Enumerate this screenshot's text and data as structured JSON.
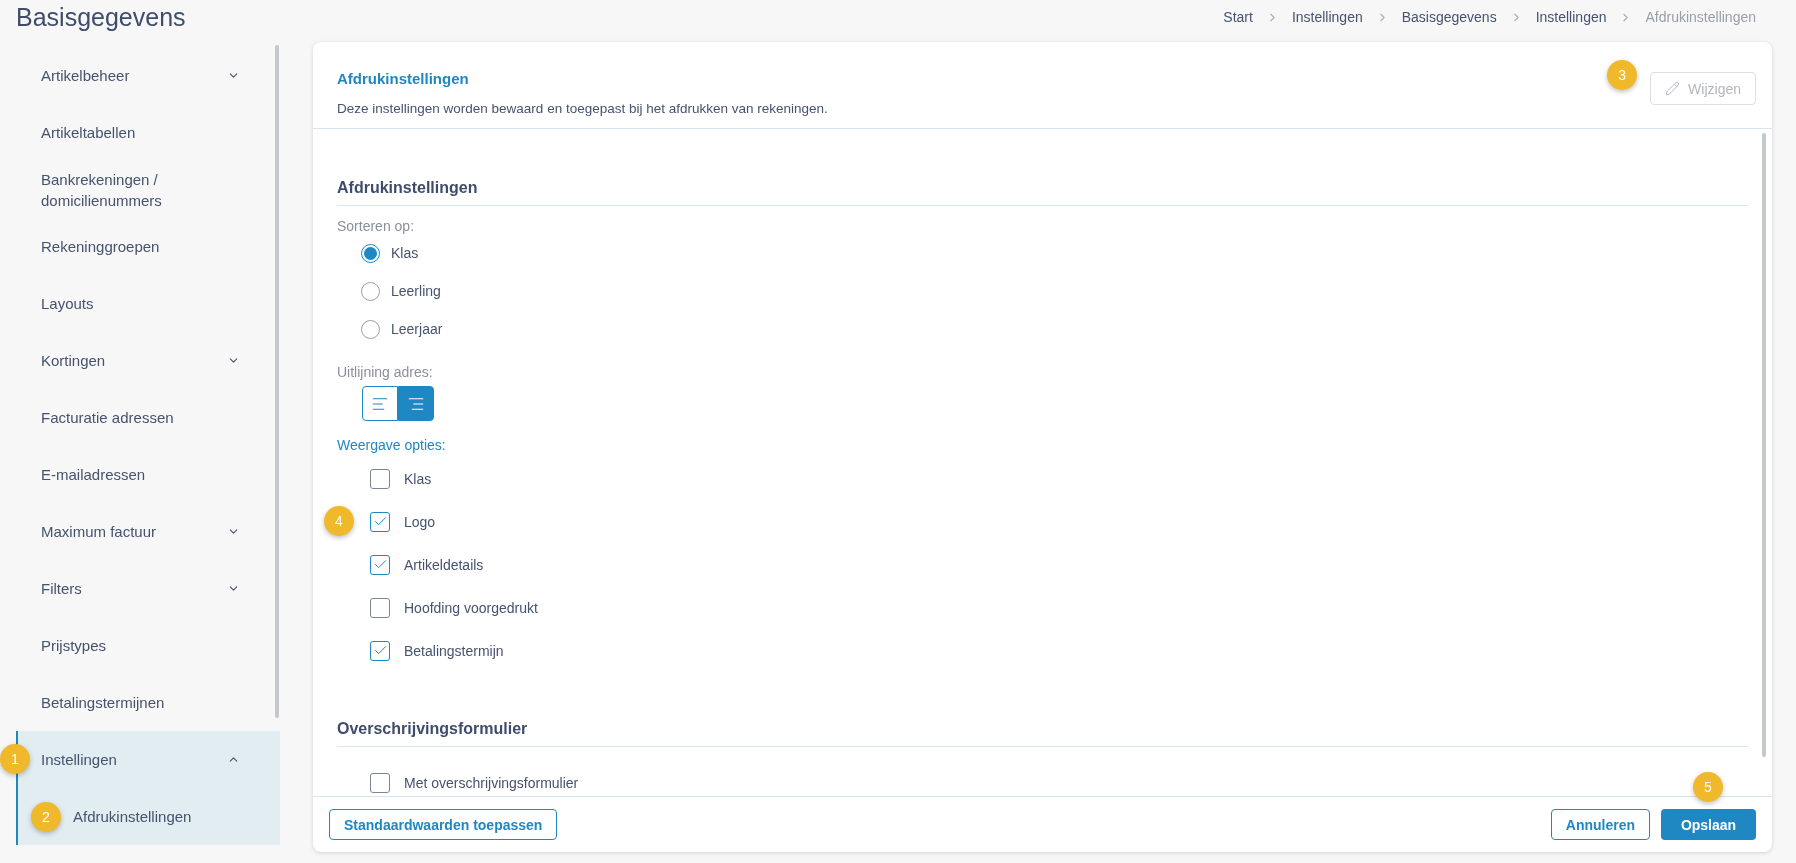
{
  "page_title": "Basisgegevens",
  "breadcrumb": [
    {
      "label": "Start",
      "current": false
    },
    {
      "label": "Instellingen",
      "current": false
    },
    {
      "label": "Basisgegevens",
      "current": false
    },
    {
      "label": "Instellingen",
      "current": false
    },
    {
      "label": "Afdrukinstellingen",
      "current": true
    }
  ],
  "sidebar": {
    "items": [
      {
        "label": "Artikelbeheer",
        "expanded": false,
        "selected": false
      },
      {
        "label": "Artikeltabellen",
        "selected": false
      },
      {
        "label": "Bankrekeningen / domicilienummers",
        "selected": false
      },
      {
        "label": "Rekeninggroepen",
        "selected": false
      },
      {
        "label": "Layouts",
        "selected": false
      },
      {
        "label": "Kortingen",
        "expanded": false,
        "selected": false
      },
      {
        "label": "Facturatie adressen",
        "selected": false
      },
      {
        "label": "E-mailadressen",
        "selected": false
      },
      {
        "label": "Maximum factuur",
        "expanded": false,
        "selected": false
      },
      {
        "label": "Filters",
        "expanded": false,
        "selected": false
      },
      {
        "label": "Prijstypes",
        "selected": false
      },
      {
        "label": "Betalingstermijnen",
        "selected": false
      },
      {
        "label": "Instellingen",
        "expanded": true,
        "selected": false,
        "badge": "1",
        "children": [
          {
            "label": "Afdrukinstellingen",
            "selected": true,
            "badge": "2"
          }
        ]
      }
    ]
  },
  "card": {
    "title": "Afdrukinstellingen",
    "description": "Deze instellingen worden bewaard en toegepast bij het afdrukken van rekeningen.",
    "edit_button": {
      "label": "Wijzigen",
      "disabled": true,
      "badge": "3"
    },
    "sections": [
      {
        "title": "Afdrukinstellingen",
        "groups": [
          {
            "kind": "radio",
            "label": "Sorteren op:",
            "options": [
              {
                "label": "Klas",
                "selected": true
              },
              {
                "label": "Leerling",
                "selected": false
              },
              {
                "label": "Leerjaar",
                "selected": false
              }
            ]
          },
          {
            "kind": "alignment",
            "label": "Uitlijning adres:",
            "options": [
              {
                "kind": "left",
                "selected": false
              },
              {
                "kind": "right",
                "selected": true
              }
            ]
          },
          {
            "kind": "checkbox",
            "label": "Weergave opties:",
            "options": [
              {
                "label": "Klas",
                "checked": false
              },
              {
                "label": "Logo",
                "checked": true,
                "badge": "4"
              },
              {
                "label": "Artikeldetails",
                "checked": true
              },
              {
                "label": "Hoofding voorgedrukt",
                "checked": false
              },
              {
                "label": "Betalingstermijn",
                "checked": true
              }
            ]
          }
        ]
      },
      {
        "title": "Overschrijvingsformulier",
        "groups": [
          {
            "kind": "checkbox",
            "options": [
              {
                "label": "Met overschrijvingsformulier",
                "checked": false
              }
            ]
          }
        ]
      }
    ],
    "footer": {
      "defaults_button": "Standaardwaarden toepassen",
      "cancel_button": "Annuleren",
      "save_button": {
        "label": "Opslaan",
        "badge": "5"
      }
    }
  }
}
